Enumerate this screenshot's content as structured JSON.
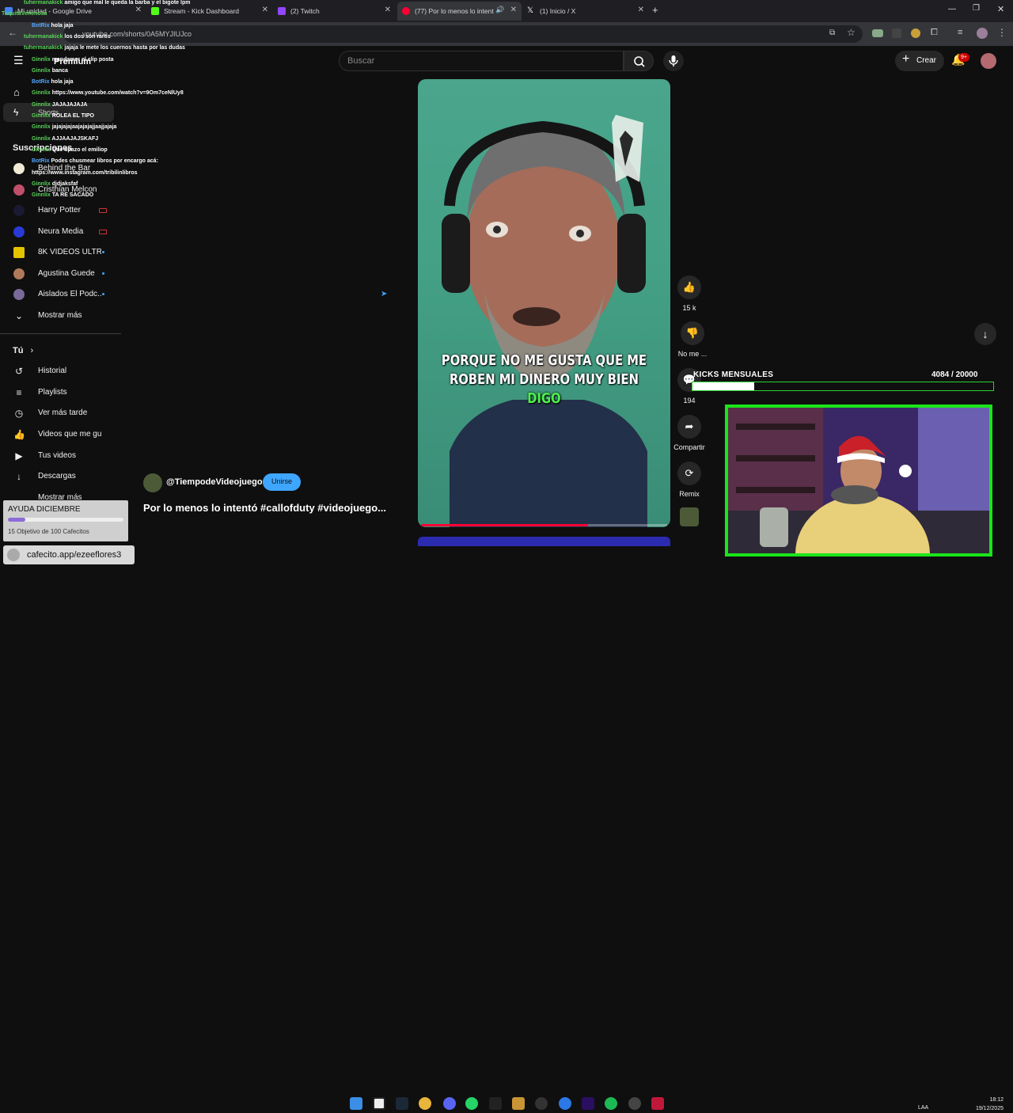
{
  "tabs": [
    {
      "label": "Mi unidad - Google Drive",
      "color": "#4285f4"
    },
    {
      "label": "Stream - Kick Dashboard",
      "color": "#53fc18"
    },
    {
      "label": "(2) Twitch",
      "color": "#9146ff"
    },
    {
      "label": "(77) Por lo menos lo intentó",
      "color": "#ff0033"
    },
    {
      "label": "(1) Inicio / X",
      "color": "#ffffff"
    }
  ],
  "new_tab": "+",
  "address": {
    "url": "youtube.com/shorts/0A5MYJIUJco"
  },
  "youtube": {
    "logo_suffix": "Premium",
    "search_placeholder": "Buscar",
    "create_label": "Crear",
    "notif_count": "9+"
  },
  "sidebar": {
    "shorts_label": "Shorts",
    "subs_heading": "Suscripciones",
    "subscriptions": [
      {
        "label": "Behind the Bar",
        "color": "#f0ead6"
      },
      {
        "label": "Cristhian Melcon",
        "color": "#c0506a"
      },
      {
        "label": "Harry Potter",
        "color": "#1a1a33",
        "live": true
      },
      {
        "label": "Neura Media",
        "color": "#2a3ad6",
        "live": true
      },
      {
        "label": "8K VIDEOS ULTR...",
        "color": "#e3c300",
        "dot": true
      },
      {
        "label": "Agustina Guede",
        "color": "#b07a5a",
        "dot": true
      },
      {
        "label": "Aislados El Podc...",
        "color": "#7a6a9a",
        "dot": true
      }
    ],
    "show_more": "Mostrar más",
    "you_heading": "Tú",
    "you_items": [
      {
        "label": "Historial",
        "icon": "history-icon"
      },
      {
        "label": "Playlists",
        "icon": "playlists-icon"
      },
      {
        "label": "Ver más tarde",
        "icon": "watch-later-icon"
      },
      {
        "label": "Videos que me gus...",
        "icon": "liked-videos-icon"
      },
      {
        "label": "Tus videos",
        "icon": "your-videos-icon"
      },
      {
        "label": "Descargas",
        "icon": "downloads-icon"
      }
    ],
    "show_more_2": "Mostrar más"
  },
  "chat": [
    {
      "user": "tuhermanakick",
      "msg": "amigo que mal le queda la barba y el bigote lpm"
    },
    {
      "user": "TuquitaVenenosa",
      "msg": ""
    },
    {
      "user": "BotRix",
      "msg": "hola jaja"
    },
    {
      "user": "tuhermanakick",
      "msg": "los dos son raros"
    },
    {
      "user": "tuhermanakick",
      "msg": "jajaja le mete los cuernos hasta por las dudas"
    },
    {
      "user": "Ginnlix",
      "msg": "mandamer el clip posta"
    },
    {
      "user": "Ginnlix",
      "msg": "banca"
    },
    {
      "user": "BotRix",
      "msg": "hola jaja"
    },
    {
      "user": "Ginnlix",
      "msg": "https://www.youtube.com/watch?v=9Om7ceNlUy8"
    },
    {
      "user": "Ginnlix",
      "msg": "JAJAJAJAJA"
    },
    {
      "user": "Ginnlix",
      "msg": "ROLEA EL TIPO"
    },
    {
      "user": "Ginnlix",
      "msg": "jajajajajaajajajajjaajjajaja"
    },
    {
      "user": "Ginnlix",
      "msg": "AJJAAJAJSKAFJ"
    },
    {
      "user": "Ginnlix",
      "msg": "Que tipazo el emiliop"
    },
    {
      "user": "BotRix",
      "msg": "Podes chusmear libros por encargo acá:"
    },
    {
      "user": "",
      "msg": "https://www.instagram.com/tribilinlibros"
    },
    {
      "user": "Ginnlix",
      "msg": "djdjaksfaf"
    },
    {
      "user": "Ginnlix",
      "msg": "TA RE SACADO"
    }
  ],
  "video": {
    "subtitle_line1": "PORQUE NO ME GUSTA QUE ME",
    "subtitle_line2": "ROBEN MI DINERO MUY BIEN",
    "subtitle_line3": "DIGO",
    "channel": "@TiempodeVideojuegos",
    "join_label": "Unirse",
    "title": "Por lo menos lo intentó #callofduty #videojuego...",
    "progress": 0.68
  },
  "actions": {
    "likes": "15 k",
    "dislike": "No me ...",
    "comments": "194",
    "share": "Compartir",
    "remix": "Remix"
  },
  "kicks": {
    "label": "KICKS MENSUALES",
    "count": "4084  / 20000",
    "fraction": 0.204
  },
  "goal": {
    "title": "AYUDA DICIEMBRE",
    "subtitle": "15 Objetivo de 100 Cafecitos",
    "fraction": 0.15
  },
  "cafecito": {
    "label": "cafecito.app/ezeeflores3"
  },
  "taskbar": {
    "lang": "LAA",
    "time": "18:12",
    "date": "19/12/2025"
  }
}
